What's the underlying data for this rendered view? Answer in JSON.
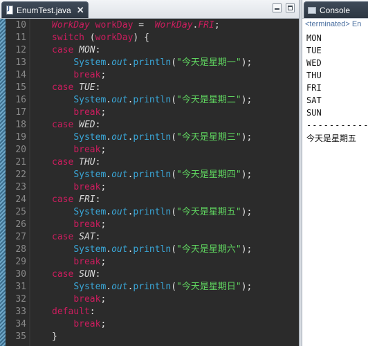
{
  "editor": {
    "tab_title": "EnumTest.java",
    "tab_close": "✕",
    "line_numbers": [
      "10",
      "11",
      "12",
      "13",
      "14",
      "15",
      "16",
      "17",
      "18",
      "19",
      "20",
      "21",
      "22",
      "23",
      "24",
      "25",
      "26",
      "27",
      "28",
      "29",
      "30",
      "31",
      "32",
      "33",
      "34",
      "35"
    ],
    "lines": [
      [
        {
          "t": "WorkDay",
          "c": "ty"
        },
        {
          "t": " ",
          "c": "pl"
        },
        {
          "t": "workDay",
          "c": "kw"
        },
        {
          "t": " =  ",
          "c": "pl"
        },
        {
          "t": "WorkDay",
          "c": "ty"
        },
        {
          "t": ".",
          "c": "pl"
        },
        {
          "t": "FRI",
          "c": "ty"
        },
        {
          "t": ";",
          "c": "pl"
        }
      ],
      [
        {
          "t": "switch",
          "c": "kw"
        },
        {
          "t": " (",
          "c": "pl"
        },
        {
          "t": "workDay",
          "c": "kw"
        },
        {
          "t": ") {",
          "c": "pl"
        }
      ],
      [
        {
          "t": "case",
          "c": "kw"
        },
        {
          "t": " ",
          "c": "pl"
        },
        {
          "t": "MON",
          "c": "en"
        },
        {
          "t": ":",
          "c": "pl"
        }
      ],
      [
        {
          "t": "    ",
          "c": "pl"
        },
        {
          "t": "System",
          "c": "sys"
        },
        {
          "t": ".",
          "c": "pl"
        },
        {
          "t": "out",
          "c": "out"
        },
        {
          "t": ".",
          "c": "pl"
        },
        {
          "t": "println",
          "c": "mt"
        },
        {
          "t": "(",
          "c": "pl"
        },
        {
          "t": "\"今天是星期一\"",
          "c": "st"
        },
        {
          "t": ");",
          "c": "pl"
        }
      ],
      [
        {
          "t": "    ",
          "c": "pl"
        },
        {
          "t": "break",
          "c": "kw"
        },
        {
          "t": ";",
          "c": "pl"
        }
      ],
      [
        {
          "t": "case",
          "c": "kw"
        },
        {
          "t": " ",
          "c": "pl"
        },
        {
          "t": "TUE",
          "c": "en"
        },
        {
          "t": ":",
          "c": "pl"
        }
      ],
      [
        {
          "t": "    ",
          "c": "pl"
        },
        {
          "t": "System",
          "c": "sys"
        },
        {
          "t": ".",
          "c": "pl"
        },
        {
          "t": "out",
          "c": "out"
        },
        {
          "t": ".",
          "c": "pl"
        },
        {
          "t": "println",
          "c": "mt"
        },
        {
          "t": "(",
          "c": "pl"
        },
        {
          "t": "\"今天是星期二\"",
          "c": "st"
        },
        {
          "t": ");",
          "c": "pl"
        }
      ],
      [
        {
          "t": "    ",
          "c": "pl"
        },
        {
          "t": "break",
          "c": "kw"
        },
        {
          "t": ";",
          "c": "pl"
        }
      ],
      [
        {
          "t": "case",
          "c": "kw"
        },
        {
          "t": " ",
          "c": "pl"
        },
        {
          "t": "WED",
          "c": "en"
        },
        {
          "t": ":",
          "c": "pl"
        }
      ],
      [
        {
          "t": "    ",
          "c": "pl"
        },
        {
          "t": "System",
          "c": "sys"
        },
        {
          "t": ".",
          "c": "pl"
        },
        {
          "t": "out",
          "c": "out"
        },
        {
          "t": ".",
          "c": "pl"
        },
        {
          "t": "println",
          "c": "mt"
        },
        {
          "t": "(",
          "c": "pl"
        },
        {
          "t": "\"今天是星期三\"",
          "c": "st"
        },
        {
          "t": ");",
          "c": "pl"
        }
      ],
      [
        {
          "t": "    ",
          "c": "pl"
        },
        {
          "t": "break",
          "c": "kw"
        },
        {
          "t": ";",
          "c": "pl"
        }
      ],
      [
        {
          "t": "case",
          "c": "kw"
        },
        {
          "t": " ",
          "c": "pl"
        },
        {
          "t": "THU",
          "c": "en"
        },
        {
          "t": ":",
          "c": "pl"
        }
      ],
      [
        {
          "t": "    ",
          "c": "pl"
        },
        {
          "t": "System",
          "c": "sys"
        },
        {
          "t": ".",
          "c": "pl"
        },
        {
          "t": "out",
          "c": "out"
        },
        {
          "t": ".",
          "c": "pl"
        },
        {
          "t": "println",
          "c": "mt"
        },
        {
          "t": "(",
          "c": "pl"
        },
        {
          "t": "\"今天是星期四\"",
          "c": "st"
        },
        {
          "t": ");",
          "c": "pl"
        }
      ],
      [
        {
          "t": "    ",
          "c": "pl"
        },
        {
          "t": "break",
          "c": "kw"
        },
        {
          "t": ";",
          "c": "pl"
        }
      ],
      [
        {
          "t": "case",
          "c": "kw"
        },
        {
          "t": " ",
          "c": "pl"
        },
        {
          "t": "FRI",
          "c": "en"
        },
        {
          "t": ":",
          "c": "pl"
        }
      ],
      [
        {
          "t": "    ",
          "c": "pl"
        },
        {
          "t": "System",
          "c": "sys"
        },
        {
          "t": ".",
          "c": "pl"
        },
        {
          "t": "out",
          "c": "out"
        },
        {
          "t": ".",
          "c": "pl"
        },
        {
          "t": "println",
          "c": "mt"
        },
        {
          "t": "(",
          "c": "pl"
        },
        {
          "t": "\"今天是星期五\"",
          "c": "st"
        },
        {
          "t": ");",
          "c": "pl"
        }
      ],
      [
        {
          "t": "    ",
          "c": "pl"
        },
        {
          "t": "break",
          "c": "kw"
        },
        {
          "t": ";",
          "c": "pl"
        }
      ],
      [
        {
          "t": "case",
          "c": "kw"
        },
        {
          "t": " ",
          "c": "pl"
        },
        {
          "t": "SAT",
          "c": "en"
        },
        {
          "t": ":",
          "c": "pl"
        }
      ],
      [
        {
          "t": "    ",
          "c": "pl"
        },
        {
          "t": "System",
          "c": "sys"
        },
        {
          "t": ".",
          "c": "pl"
        },
        {
          "t": "out",
          "c": "out"
        },
        {
          "t": ".",
          "c": "pl"
        },
        {
          "t": "println",
          "c": "mt"
        },
        {
          "t": "(",
          "c": "pl"
        },
        {
          "t": "\"今天是星期六\"",
          "c": "st"
        },
        {
          "t": ");",
          "c": "pl"
        }
      ],
      [
        {
          "t": "    ",
          "c": "pl"
        },
        {
          "t": "break",
          "c": "kw"
        },
        {
          "t": ";",
          "c": "pl"
        }
      ],
      [
        {
          "t": "case",
          "c": "kw"
        },
        {
          "t": " ",
          "c": "pl"
        },
        {
          "t": "SUN",
          "c": "en"
        },
        {
          "t": ":",
          "c": "pl"
        }
      ],
      [
        {
          "t": "    ",
          "c": "pl"
        },
        {
          "t": "System",
          "c": "sys"
        },
        {
          "t": ".",
          "c": "pl"
        },
        {
          "t": "out",
          "c": "out"
        },
        {
          "t": ".",
          "c": "pl"
        },
        {
          "t": "println",
          "c": "mt"
        },
        {
          "t": "(",
          "c": "pl"
        },
        {
          "t": "\"今天是星期日\"",
          "c": "st"
        },
        {
          "t": ");",
          "c": "pl"
        }
      ],
      [
        {
          "t": "    ",
          "c": "pl"
        },
        {
          "t": "break",
          "c": "kw"
        },
        {
          "t": ";",
          "c": "pl"
        }
      ],
      [
        {
          "t": "default",
          "c": "kw"
        },
        {
          "t": ":",
          "c": "pl"
        }
      ],
      [
        {
          "t": "    ",
          "c": "pl"
        },
        {
          "t": "break",
          "c": "kw"
        },
        {
          "t": ";",
          "c": "pl"
        }
      ],
      [
        {
          "t": "}",
          "c": "pl"
        }
      ]
    ]
  },
  "console": {
    "tab_title": "Console",
    "status": "<terminated> En",
    "output_lines": [
      "MON",
      "TUE",
      "WED",
      "THU",
      "FRI",
      "SAT",
      "SUN"
    ],
    "separator": "-----------",
    "result": "今天是星期五"
  },
  "colors": {
    "editor_bg": "#2b2b2b",
    "keyword": "#cc1d5e",
    "type_identifier": "#d8d8d8",
    "system_method": "#3aa7d8",
    "string": "#5fd35f",
    "tab_active": "#2d3642"
  }
}
